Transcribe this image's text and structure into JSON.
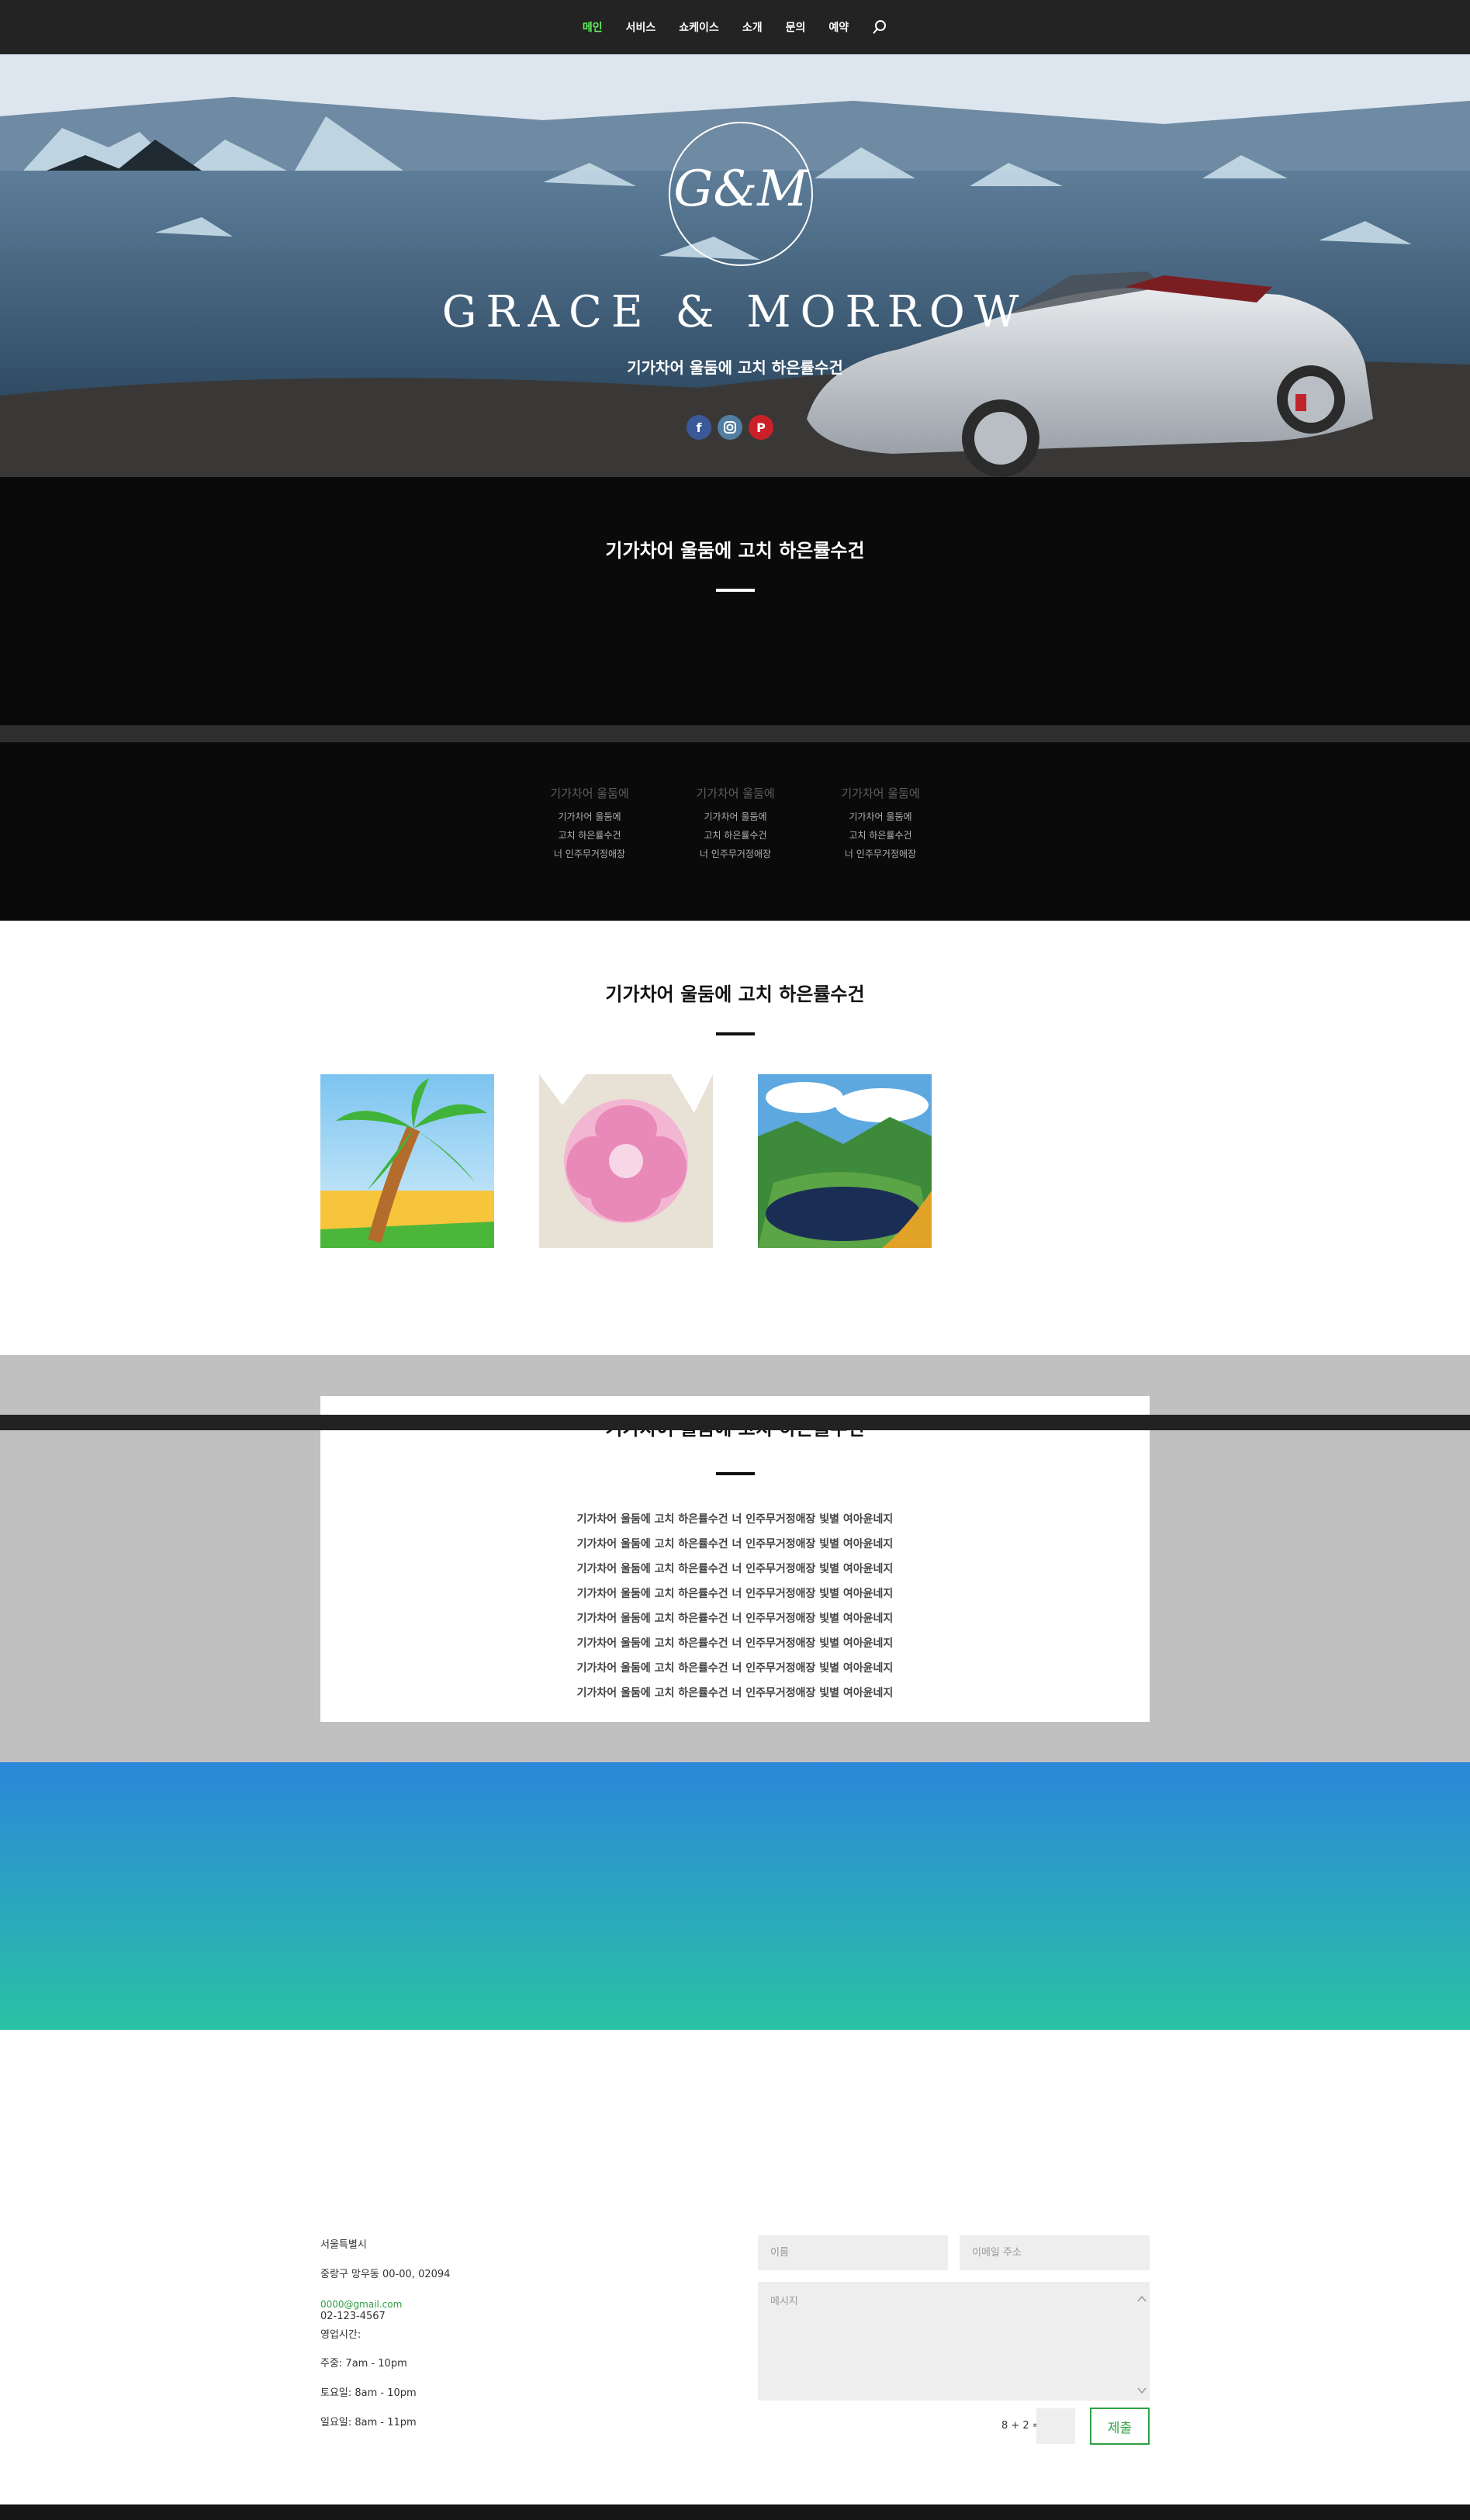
{
  "nav": {
    "items": [
      {
        "label": "메인",
        "active": true
      },
      {
        "label": "서비스",
        "active": false
      },
      {
        "label": "쇼케이스",
        "active": false
      },
      {
        "label": "소개",
        "active": false
      },
      {
        "label": "문의",
        "active": false
      },
      {
        "label": "예약",
        "active": false
      }
    ],
    "search_icon": "search-icon",
    "active_color": "#5df05d"
  },
  "hero": {
    "logo_text": "G&M",
    "title": "GRACE & MORROW",
    "subtitle": "기가차어 울둠에 고치 하은률수건",
    "social": [
      "facebook-icon",
      "instagram-icon",
      "pinterest-icon"
    ]
  },
  "section1": {
    "heading": "기가차어 울둠에 고치 하은률수건"
  },
  "section2": {
    "columns": [
      {
        "title": "기가차어 울둠에",
        "lines": [
          "기가차어 울둠에",
          "고치 하은률수건",
          "너 인주무거정애장"
        ]
      },
      {
        "title": "기가차어 울둠에",
        "lines": [
          "기가차어 울둠에",
          "고치 하은률수건",
          "너 인주무거정애장"
        ]
      },
      {
        "title": "기가차어 울둠에",
        "lines": [
          "기가차어 울둠에",
          "고치 하은률수건",
          "너 인주무거정애장"
        ]
      }
    ]
  },
  "section3": {
    "heading": "기가차어 울둠에 고치 하은률수건",
    "images": [
      "palm-tree-image",
      "flower-image",
      "lake-image"
    ]
  },
  "section4": {
    "heading": "기가차어 울둠에 고치 하은률수건",
    "lines": [
      "기가차어 울둠에 고치 하은률수건 너 인주무거정애장 빛별 여아윤네지",
      "기가차어 울둠에 고치 하은률수건 너 인주무거정애장 빛별 여아윤네지",
      "기가차어 울둠에 고치 하은률수건 너 인주무거정애장 빛별 여아윤네지",
      "기가차어 울둠에 고치 하은률수건 너 인주무거정애장 빛별 여아윤네지",
      "기가차어 울둠에 고치 하은률수건 너 인주무거정애장 빛별 여아윤네지",
      "기가차어 울둠에 고치 하은률수건 너 인주무거정애장 빛별 여아윤네지",
      "기가차어 울둠에 고치 하은률수건 너 인주무거정애장 빛별 여아윤네지",
      "기가차어 울둠에 고치 하은률수건 너 인주무거정애장 빛별 여아윤네지"
    ]
  },
  "contact": {
    "city": "서울특별시",
    "address": "중랑구 망우동 00-00, 02094",
    "email": "0000@gmail.com",
    "phone": "02-123-4567",
    "hours_label": "영업시간:",
    "weekday": "주중: 7am - 10pm",
    "saturday": "토요일: 8am - 10pm",
    "sunday": "일요일: 8am - 11pm",
    "name_placeholder": "이름",
    "email_placeholder": "이메일 주소",
    "message_placeholder": "메시지",
    "captcha": "8 + 2 =",
    "submit_label": "제출",
    "accent_color": "#2ea043"
  }
}
